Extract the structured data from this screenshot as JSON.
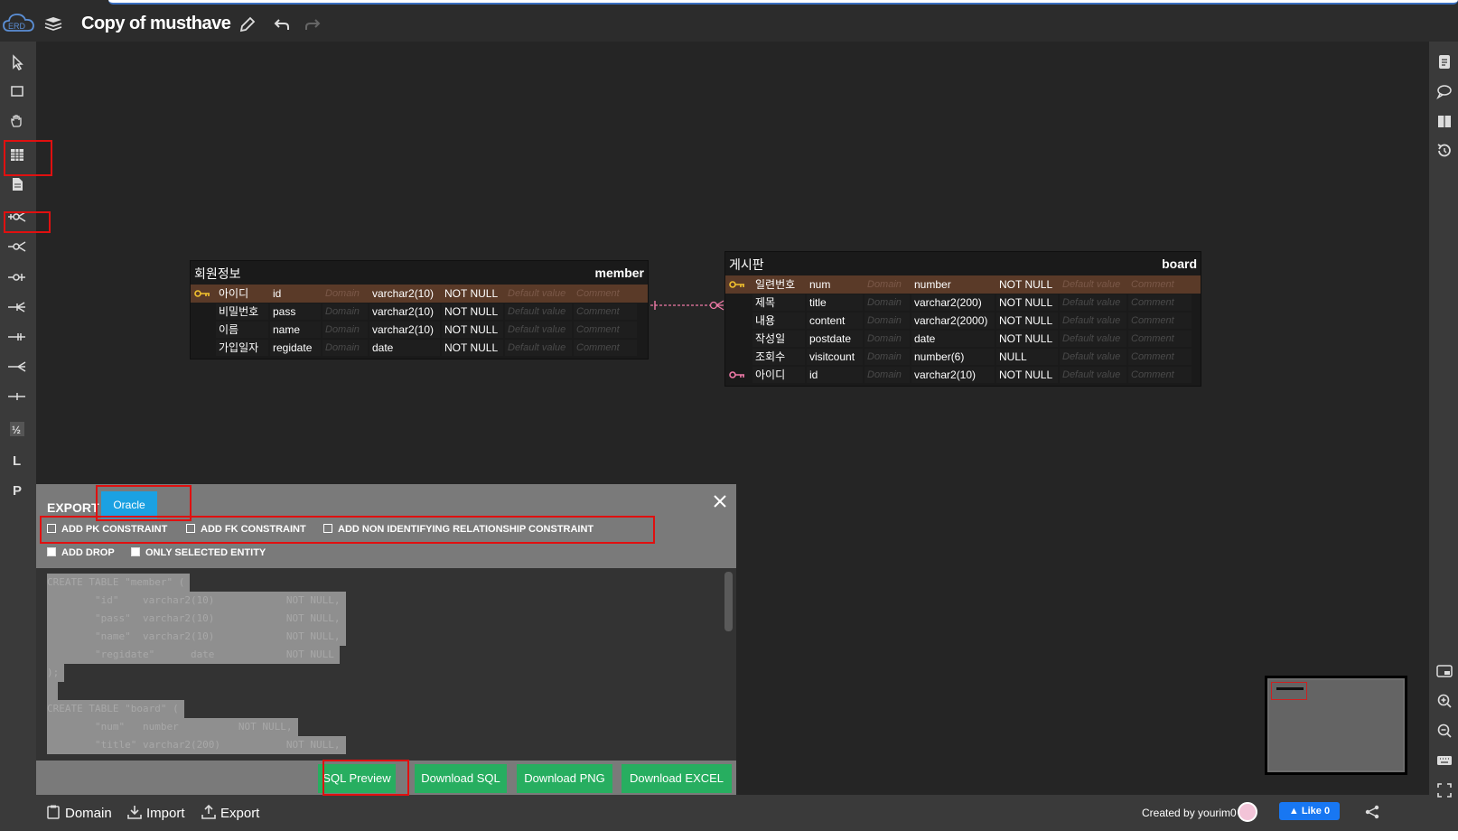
{
  "app": {
    "title": "Copy of musthave"
  },
  "entities": {
    "member": {
      "logical_name": "회원정보",
      "physical_name": "member",
      "rows": [
        {
          "pk": true,
          "lname": "아이디",
          "pname": "id",
          "domain": "Domain",
          "type": "varchar2(10)",
          "null": "NOT NULL",
          "default": "Default value",
          "comment": "Comment"
        },
        {
          "pk": false,
          "lname": "비밀번호",
          "pname": "pass",
          "domain": "Domain",
          "type": "varchar2(10)",
          "null": "NOT NULL",
          "default": "Default value",
          "comment": "Comment"
        },
        {
          "pk": false,
          "lname": "이름",
          "pname": "name",
          "domain": "Domain",
          "type": "varchar2(10)",
          "null": "NOT NULL",
          "default": "Default value",
          "comment": "Comment"
        },
        {
          "pk": false,
          "lname": "가입일자",
          "pname": "regidate",
          "domain": "Domain",
          "type": "date",
          "null": "NOT NULL",
          "default": "Default value",
          "comment": "Comment"
        }
      ]
    },
    "board": {
      "logical_name": "게시판",
      "physical_name": "board",
      "rows": [
        {
          "pk": true,
          "lname": "일련번호",
          "pname": "num",
          "domain": "Domain",
          "type": "number",
          "null": "NOT NULL",
          "default": "Default value",
          "comment": "Comment"
        },
        {
          "pk": false,
          "lname": "제목",
          "pname": "title",
          "domain": "Domain",
          "type": "varchar2(200)",
          "null": "NOT NULL",
          "default": "Default value",
          "comment": "Comment"
        },
        {
          "pk": false,
          "lname": "내용",
          "pname": "content",
          "domain": "Domain",
          "type": "varchar2(2000)",
          "null": "NOT NULL",
          "default": "Default value",
          "comment": "Comment"
        },
        {
          "pk": false,
          "lname": "작성일",
          "pname": "postdate",
          "domain": "Domain",
          "type": "date",
          "null": "NOT NULL",
          "default": "Default value",
          "comment": "Comment"
        },
        {
          "pk": false,
          "lname": "조회수",
          "pname": "visitcount",
          "domain": "Domain",
          "type": "number(6)",
          "null": "NULL",
          "default": "Default value",
          "comment": "Comment"
        },
        {
          "pk": false,
          "fk": true,
          "lname": "아이디",
          "pname": "id",
          "domain": "Domain",
          "type": "varchar2(10)",
          "null": "NOT NULL",
          "default": "Default value",
          "comment": "Comment"
        }
      ]
    }
  },
  "export": {
    "title": "EXPORT",
    "db": "Oracle",
    "options": {
      "add_pk": "ADD PK CONSTRAINT",
      "add_fk": "ADD FK CONSTRAINT",
      "add_non_identifying": "ADD NON IDENTIFYING RELATIONSHIP CONSTRAINT",
      "add_drop": "ADD DROP",
      "only_selected": "ONLY SELECTED ENTITY"
    },
    "sql_lines": [
      "CREATE TABLE \"member\" (",
      "        \"id\"    varchar2(10)            NOT NULL,",
      "        \"pass\"  varchar2(10)            NOT NULL,",
      "        \"name\"  varchar2(10)            NOT NULL,",
      "        \"regidate\"      date            NOT NULL",
      ");",
      "",
      "CREATE TABLE \"board\" (",
      "        \"num\"   number          NOT NULL,",
      "        \"title\" varchar2(200)           NOT NULL,"
    ],
    "buttons": {
      "sql_preview": "SQL Preview",
      "download_sql": "Download SQL",
      "download_png": "Download PNG",
      "download_excel": "Download EXCEL"
    }
  },
  "bottom": {
    "domain": "Domain",
    "import": "Import",
    "export": "Export",
    "created_by": "Created by yourim0",
    "like": "Like 0"
  },
  "colors": {
    "canvas": "#252525",
    "toolbar": "#3a3a3a",
    "oracle": "#1ba1e2",
    "button_green": "#27ae60",
    "pk_row": "#5a3a28",
    "annotation_red": "#e01010",
    "relation_pink": "#f07aa8"
  },
  "icons": {
    "left_tools": [
      "pointer-icon",
      "selection-icon",
      "hand-icon",
      "table-icon",
      "memo-icon",
      "zero-one-n-icon",
      "zero-n-icon",
      "zero-one-icon",
      "one-n-icon",
      "one-only-icon",
      "n-icon",
      "one-icon",
      "sort-icon",
      "logical-icon",
      "physical-icon"
    ],
    "right_tools": [
      "history-list-icon",
      "comment-icon",
      "book-icon",
      "restore-icon",
      "minimap-toggle-icon",
      "zoom-in-icon",
      "zoom-out-icon",
      "keyboard-icon",
      "fullscreen-icon"
    ]
  }
}
